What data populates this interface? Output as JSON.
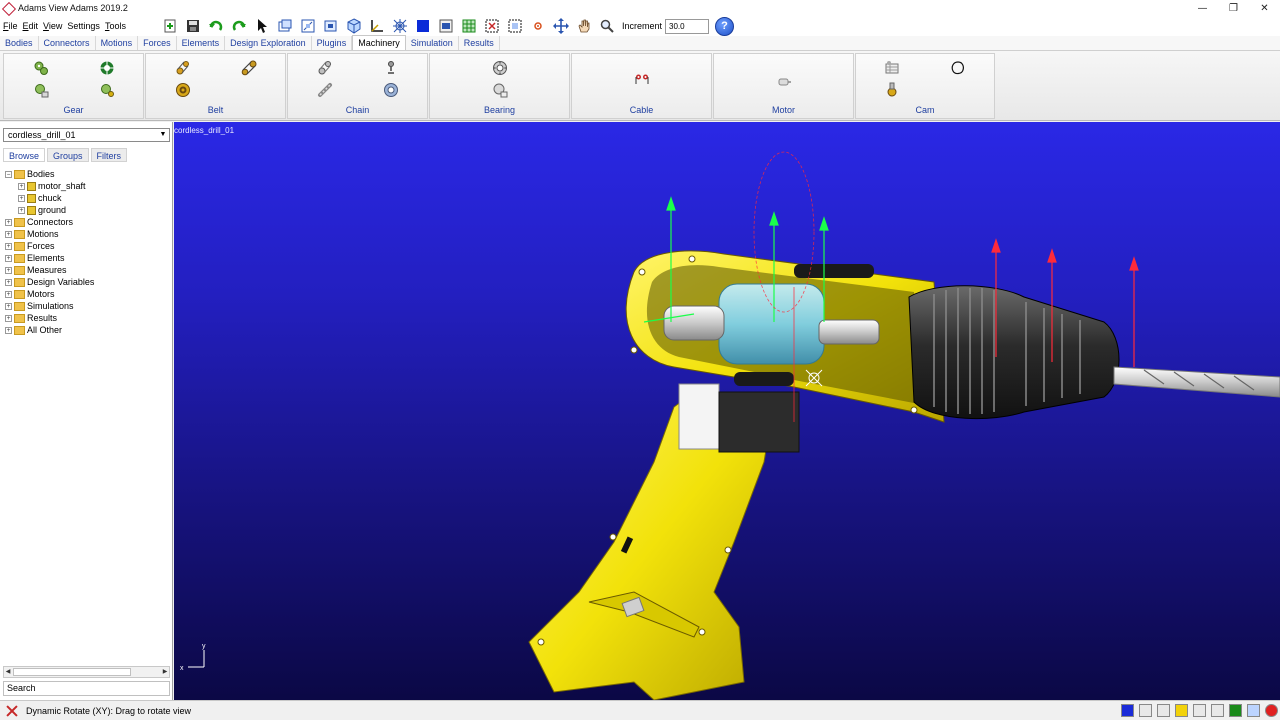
{
  "window": {
    "title": "Adams View Adams 2019.2",
    "controls": [
      "—",
      "❐",
      "✕"
    ]
  },
  "menu": [
    {
      "label": "File",
      "accel": "F",
      "rest": "ile"
    },
    {
      "label": "Edit",
      "accel": "E",
      "rest": "dit"
    },
    {
      "label": "View",
      "accel": "V",
      "rest": "iew"
    },
    {
      "label": "Settings",
      "accel": "",
      "rest": "Settings"
    },
    {
      "label": "Tools",
      "accel": "T",
      "rest": "ools"
    }
  ],
  "toolbar": {
    "increment_label": "Increment",
    "increment_value": "30.0",
    "help_label": "?"
  },
  "tabs": [
    "Bodies",
    "Connectors",
    "Motions",
    "Forces",
    "Elements",
    "Design Exploration",
    "Plugins",
    "Machinery",
    "Simulation",
    "Results"
  ],
  "active_tab": "Machinery",
  "ribbon": {
    "groups": [
      "Gear",
      "Belt",
      "Chain",
      "Bearing",
      "Cable",
      "Motor",
      "Cam"
    ]
  },
  "browser": {
    "model": "cordless_drill_01",
    "subtabs": [
      "Browse",
      "Groups",
      "Filters"
    ],
    "tree": [
      {
        "label": "Bodies",
        "level": 0,
        "expanded": true,
        "kind": "folder"
      },
      {
        "label": "motor_shaft",
        "level": 1,
        "kind": "body"
      },
      {
        "label": "chuck",
        "level": 1,
        "kind": "body"
      },
      {
        "label": "ground",
        "level": 1,
        "kind": "body"
      },
      {
        "label": "Connectors",
        "level": 0,
        "kind": "folder"
      },
      {
        "label": "Motions",
        "level": 0,
        "kind": "folder"
      },
      {
        "label": "Forces",
        "level": 0,
        "kind": "folder"
      },
      {
        "label": "Elements",
        "level": 0,
        "kind": "folder"
      },
      {
        "label": "Measures",
        "level": 0,
        "kind": "folder"
      },
      {
        "label": "Design Variables",
        "level": 0,
        "kind": "folder"
      },
      {
        "label": "Motors",
        "level": 0,
        "kind": "folder"
      },
      {
        "label": "Simulations",
        "level": 0,
        "kind": "folder"
      },
      {
        "label": "Results",
        "level": 0,
        "kind": "folder"
      },
      {
        "label": "All Other",
        "level": 0,
        "kind": "folder"
      }
    ],
    "search_placeholder": "Search"
  },
  "viewport": {
    "model_label": "cordless_drill_01",
    "triad_y": "y",
    "triad_x": "x"
  },
  "status": {
    "text": "Dynamic Rotate (XY): Drag to rotate view"
  },
  "colors": {
    "accent_link": "#1f3fa0",
    "drill_body": "#f2e20a",
    "viewport_top": "#2a28e6",
    "viewport_bottom": "#0b0845"
  }
}
